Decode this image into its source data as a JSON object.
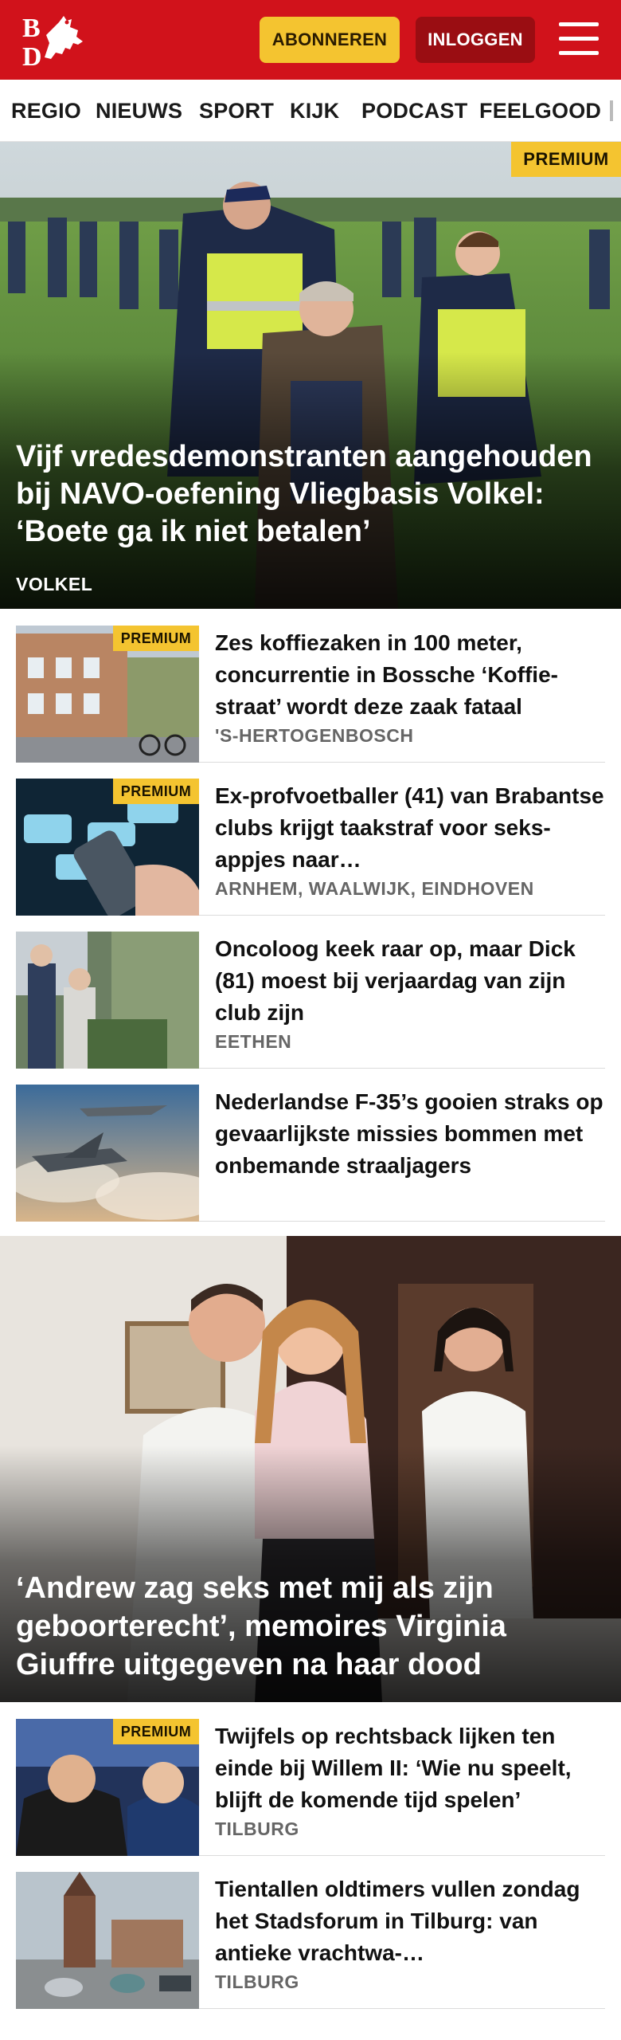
{
  "header": {
    "logo_text": "BD",
    "subscribe_label": "ABONNEREN",
    "login_label": "INLOGGEN",
    "brand_color": "#d1121b"
  },
  "nav": {
    "items": [
      "REGIO",
      "NIEUWS",
      "SPORT",
      "KIJK",
      "PODCAST",
      "FEELGOOD"
    ]
  },
  "premium_label": "PREMIUM",
  "hero": {
    "title": "Vijf vredesdemonstranten aangehou­den bij NAVO-oefening Vliegbasis Volkel: ‘Boete ga ik niet betalen’",
    "location": "VOLKEL",
    "premium": true
  },
  "articles": [
    {
      "title": "Zes koffiezaken in 100 meter, concurrentie in Bossche ‘Koffie­straat’ wordt deze zaak fataal",
      "location": "'S-HERTOGENBOSCH",
      "premium": true
    },
    {
      "title": "Ex-profvoetballer (41) van Brabantse clubs krijgt taakstraf voor seks-appjes naar…",
      "location": "ARNHEM, WAALWIJK, EINDHOVEN",
      "premium": true
    },
    {
      "title": "Oncoloog keek raar op, maar Dick (81) moest bij verjaardag van zijn club zijn",
      "location": "EETHEN",
      "premium": false
    },
    {
      "title": "Nederlandse F-35’s gooien straks op gevaarlijkste missies bommen met onbemande straaljagers",
      "location": "",
      "premium": false
    }
  ],
  "feature": {
    "title": "‘Andrew zag seks met mij als zijn geboorterecht’, memoires Virginia Giuffre uitgegeven na haar dood"
  },
  "articles2": [
    {
      "title": "Twijfels op rechtsback lijken ten einde bij Willem II: ‘Wie nu speelt, blijft de komende tijd spelen’",
      "location": "TILBURG",
      "premium": true
    },
    {
      "title": "Tientallen oldtimers vullen zondag het Stadsforum in Tilburg: van antieke vrachtwa-…",
      "location": "TILBURG",
      "premium": false
    }
  ]
}
